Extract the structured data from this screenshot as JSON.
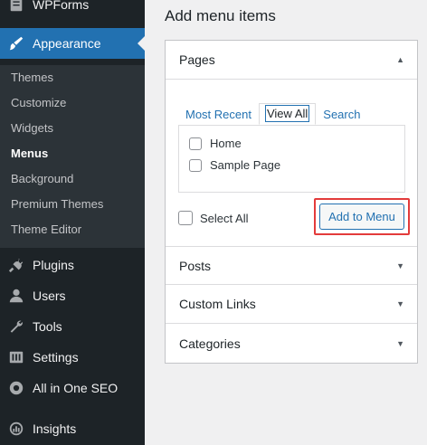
{
  "sidebar": {
    "top_items": [
      {
        "label": "WPForms",
        "icon": "wpforms-icon"
      },
      {
        "label": "Appearance",
        "icon": "paintbrush-icon"
      },
      {
        "label": "Plugins",
        "icon": "plugin-icon"
      },
      {
        "label": "Users",
        "icon": "user-icon"
      },
      {
        "label": "Tools",
        "icon": "wrench-icon"
      },
      {
        "label": "Settings",
        "icon": "settings-icon"
      },
      {
        "label": "All in One SEO",
        "icon": "aioseo-icon"
      },
      {
        "label": "Insights",
        "icon": "insights-icon"
      }
    ],
    "submenu": [
      {
        "label": "Themes"
      },
      {
        "label": "Customize"
      },
      {
        "label": "Widgets"
      },
      {
        "label": "Menus",
        "current": true
      },
      {
        "label": "Background"
      },
      {
        "label": "Premium Themes"
      },
      {
        "label": "Theme Editor"
      }
    ]
  },
  "main": {
    "heading": "Add menu items",
    "pages_section": {
      "title": "Pages",
      "tabs": [
        "Most Recent",
        "View All",
        "Search"
      ],
      "active_tab": "View All",
      "items": [
        "Home",
        "Sample Page"
      ],
      "select_all_label": "Select All",
      "add_button_label": "Add to Menu"
    },
    "collapsed_sections": [
      "Posts",
      "Custom Links",
      "Categories"
    ]
  },
  "colors": {
    "sidebar_bg": "#1d2327",
    "submenu_bg": "#2c3338",
    "accent": "#2271b1",
    "highlight_box": "#e33b3b"
  }
}
